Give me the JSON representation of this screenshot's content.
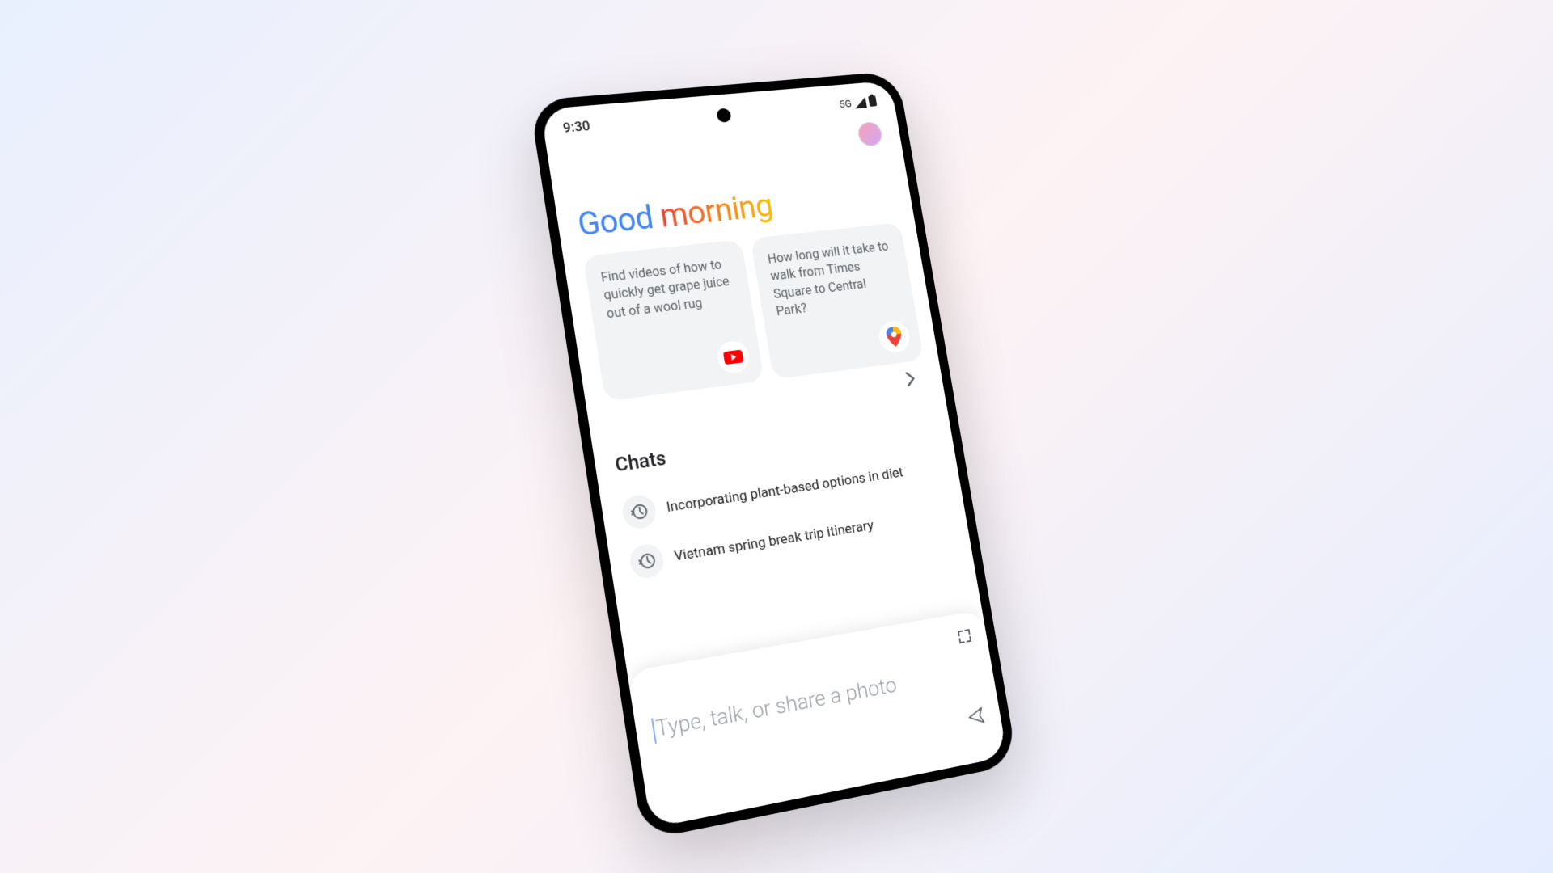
{
  "status_bar": {
    "time": "9:30",
    "network_label": "5G"
  },
  "greeting": {
    "word1": "Good",
    "word2": "morning"
  },
  "suggestions": [
    {
      "text": "Find videos of how to quickly get grape juice out of a wool rug",
      "icon": "youtube"
    },
    {
      "text": "How long will it take to walk from Times Square to Central Park?",
      "icon": "maps"
    }
  ],
  "chats": {
    "title": "Chats",
    "items": [
      {
        "label": "Incorporating plant-based options in diet"
      },
      {
        "label": "Vietnam spring break trip itinerary"
      }
    ]
  },
  "input": {
    "placeholder": "Type, talk, or share a photo"
  }
}
